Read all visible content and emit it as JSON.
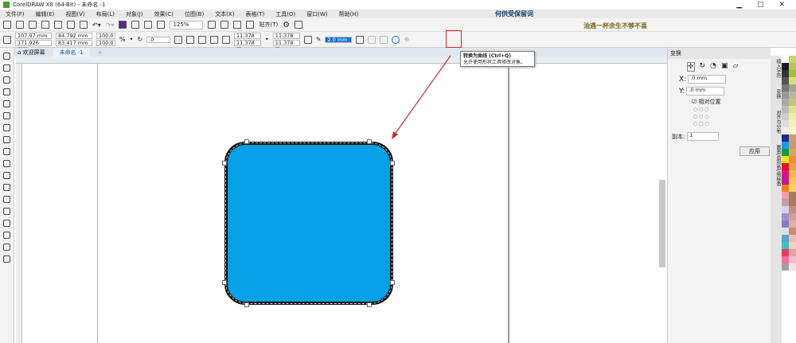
{
  "window": {
    "title": "CorelDRAW X8 (64-Bit) - 未命名 -1"
  },
  "menu": [
    "文件(F)",
    "编辑(E)",
    "视图(V)",
    "布局(L)",
    "对象(J)",
    "效果(C)",
    "位图(B)",
    "文本(X)",
    "表格(T)",
    "工具(O)",
    "窗口(W)",
    "帮助(H)"
  ],
  "toolbar": {
    "zoom": "125%",
    "snap": "贴齐(T)"
  },
  "property_bar": {
    "x": "107.97 mm",
    "y": "171.926 mm",
    "width": "84.792 mm",
    "height": "83.417 mm",
    "scale_x": "100.0",
    "scale_y": "100.0",
    "pct": "%",
    "rotation": ".0",
    "corner1": "11.378 m",
    "corner2": "11.378 m",
    "corner3": "11.378 m",
    "corner4": "11.378 m",
    "outline": "2.0 mm"
  },
  "tabs": [
    {
      "label": "欢迎屏幕"
    },
    {
      "label": "未命名 -1"
    }
  ],
  "watermark": {
    "line1": "何供受保留词",
    "line2": "油遇一杯余生不够不喜"
  },
  "tooltip": {
    "title": "转换为曲线 (Ctrl+Q)",
    "body": "允许使用形状工具修改对象。"
  },
  "transform_panel": {
    "title": "变换",
    "x_value": ".0 mm",
    "y_value": ".0 mm",
    "relative_label": "相对位置",
    "copies_label": "副本:",
    "copies_value": "1",
    "apply_label": "应用",
    "x_label": "X:",
    "y_label": "Y:"
  },
  "side_tabs": [
    "插入字符",
    "变换",
    "对齐与分布",
    "圆角/扇形角/倒棱角"
  ],
  "colors": {
    "shape_fill": "#079fe6",
    "highlight": "#e02020",
    "arrow": "#c0302a"
  },
  "palette": [
    "#ffffff",
    "#c8d36a",
    "#1a1a1a",
    "#b5c65a",
    "#333",
    "#9cc03c",
    "#555",
    "#d8e07a",
    "#777",
    "#a0a590",
    "#999",
    "#b8b89a",
    "#aaa",
    "#c9c27c",
    "#bbb",
    "#e6e08a",
    "#ccc",
    "#f0ee9a",
    "#ddd",
    "#f4f0b8",
    "#eee",
    "#fbf6c8",
    "#1e2a8a",
    "#c6a070",
    "#1a9be0",
    "#c89a6a",
    "#149a3a",
    "#d4a860",
    "#f0e020",
    "#e8903a",
    "#e01030",
    "#f0a040",
    "#e0107a",
    "#f4b850",
    "#c01890",
    "#f8c848",
    "#f08020",
    "#f8d070",
    "#f0a0a0",
    "#a08060",
    "#c0a0b0",
    "#b07858",
    "#d8d0e8",
    "#c09080",
    "#a090d0",
    "#d0a090",
    "#8080c0",
    "#e0b0a0",
    "#e0e0e0",
    "#d08878",
    "#60a0d0",
    "#e8c0b0",
    "#40c0c0",
    "#f0d0c0",
    "#e04060",
    "#e8a0a0",
    "#f070a0",
    "#f0c0d0",
    "#a0a0a0",
    "#f8e0e0"
  ]
}
